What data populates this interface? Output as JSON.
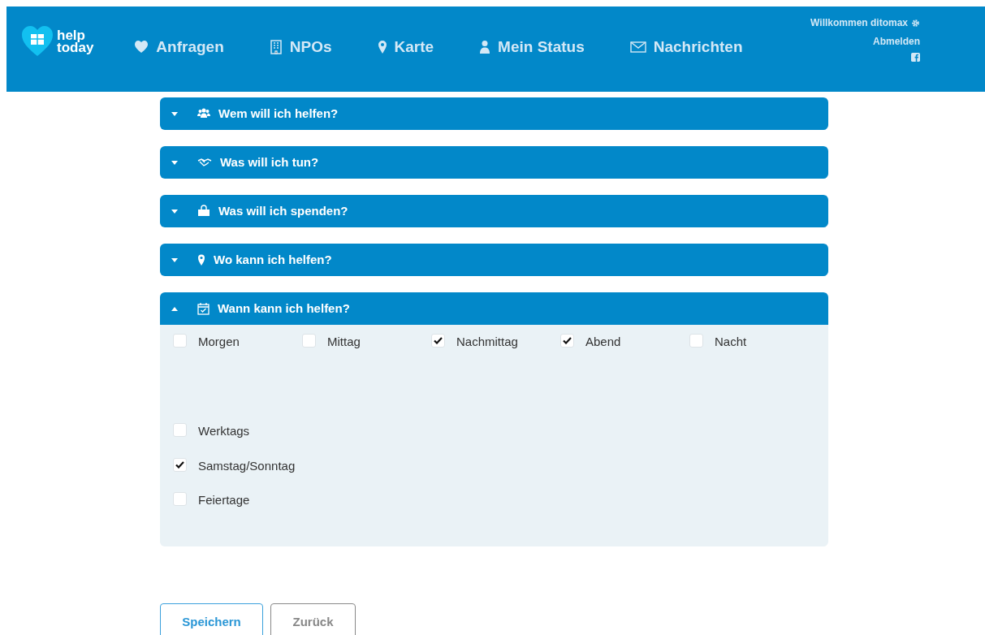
{
  "brand": {
    "line_1": "help",
    "line_2": "today"
  },
  "nav": [
    {
      "label": "Anfragen"
    },
    {
      "label": "NPOs"
    },
    {
      "label": "Karte"
    },
    {
      "label": "Mein Status"
    },
    {
      "label": "Nachrichten"
    }
  ],
  "user": {
    "greeting": "Willkommen ditomax",
    "logout": "Abmelden"
  },
  "sections": [
    {
      "title": "Wem will ich helfen?",
      "expanded": false
    },
    {
      "title": "Was will ich tun?",
      "expanded": false
    },
    {
      "title": "Was will ich spenden?",
      "expanded": false
    },
    {
      "title": "Wo kann ich helfen?",
      "expanded": false
    },
    {
      "title": "Wann kann ich helfen?",
      "expanded": true,
      "groups": [
        {
          "kind": "row",
          "options": [
            {
              "label": "Morgen",
              "checked": false
            },
            {
              "label": "Mittag",
              "checked": false
            },
            {
              "label": "Nachmittag",
              "checked": true
            },
            {
              "label": "Abend",
              "checked": true
            },
            {
              "label": "Nacht",
              "checked": false
            }
          ]
        },
        {
          "kind": "column",
          "options": [
            {
              "label": "Werktags",
              "checked": false
            },
            {
              "label": "Samstag/Sonntag",
              "checked": true
            },
            {
              "label": "Feiertage",
              "checked": false
            }
          ]
        }
      ]
    }
  ],
  "buttons": [
    {
      "label": "Speichern",
      "kind": "primary"
    },
    {
      "label": "Zurück",
      "kind": "secondary"
    }
  ]
}
